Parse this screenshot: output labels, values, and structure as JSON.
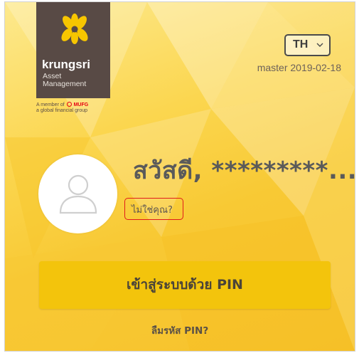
{
  "logo": {
    "wordmark": "krungsri",
    "sub_line1": "Asset",
    "sub_line2": "Management",
    "member_prefix": "A member of",
    "member_brand": "MUFG",
    "group_line": "a global financial group"
  },
  "header": {
    "language": "TH",
    "version": "master 2019-02-18"
  },
  "user": {
    "greeting": "สวัสดี, *********...",
    "not_you": "ไม่ใช่คุณ?"
  },
  "actions": {
    "pin_login": "เข้าสู่ระบบด้วย PIN",
    "forgot_pin": "ลืมรหัส PIN?"
  },
  "colors": {
    "accent": "#f3c40c",
    "brand_dark": "#584a45",
    "highlight_box": "#e11b1b",
    "mufg_red": "#e60012"
  },
  "icons": {
    "logo_symbol": "krungsri-logo-icon",
    "language_dropdown": "chevron-down-icon",
    "avatar": "user-avatar-icon"
  }
}
